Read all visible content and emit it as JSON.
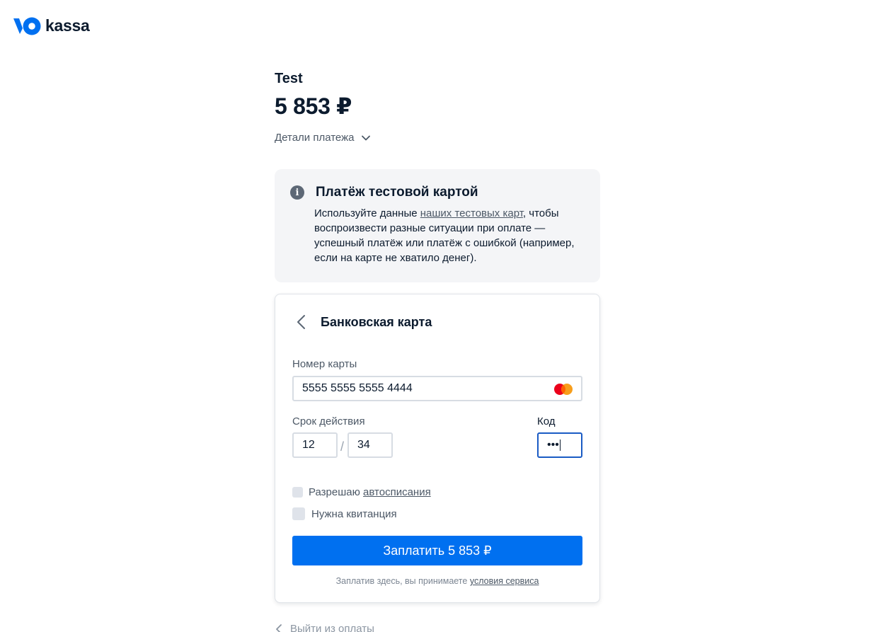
{
  "logo": {
    "text": "kassa"
  },
  "payment": {
    "merchant": "Test",
    "amount": "5 853 ₽",
    "details_label": "Детали платежа"
  },
  "notice": {
    "title": "Платёж тестовой картой",
    "body_prefix": "Используйте данные ",
    "link_text": "наших тестовых карт",
    "body_suffix": ", чтобы воспроизвести разные ситуации при оплате — успешный платёж или платёж с ошибкой (например, если на карте не хватило денег)."
  },
  "form": {
    "title": "Банковская карта",
    "card_number_label": "Номер карты",
    "card_number_value": "5555 5555 5555 4444",
    "expiry_label": "Срок действия",
    "expiry_month": "12",
    "expiry_separator": "/",
    "expiry_year": "34",
    "cvc_label": "Код",
    "cvc_value": "•••",
    "autopay_prefix": "Разрешаю ",
    "autopay_link": "автосписания",
    "receipt_label": "Нужна квитанция",
    "pay_button": "Заплатить 5 853 ₽",
    "terms_prefix": "Заплатив здесь, вы принимаете ",
    "terms_link": "условия сервиса"
  },
  "footer": {
    "exit_label": "Выйти из оплаты"
  },
  "colors": {
    "accent": "#0070f0",
    "focus": "#1a5bc4",
    "text": "#0c1b2e",
    "muted": "#4c5866",
    "notice_bg": "#f4f5f7"
  },
  "icons": {
    "logo": "yookassa-logo-icon",
    "chevron": "chevron-down-icon",
    "info": "info-icon",
    "back": "chevron-left-icon",
    "card_brand": "mastercard-icon"
  }
}
